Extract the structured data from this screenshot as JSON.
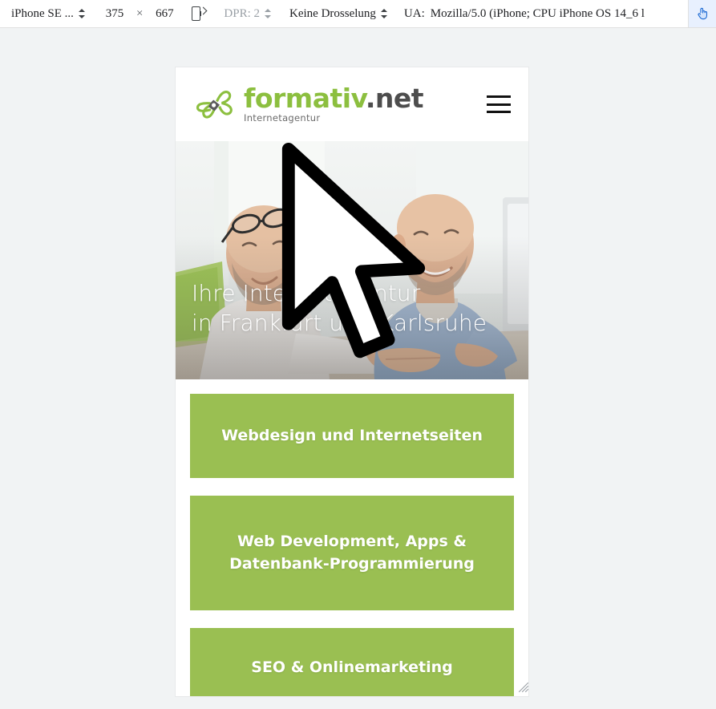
{
  "devtools_toolbar": {
    "device_name": "iPhone SE ...",
    "width": "375",
    "height": "667",
    "times_symbol": "×",
    "rotate_icon": "rotate-device-icon",
    "dpr_label": "DPR: 2",
    "throttling": "Keine Drosselung",
    "ua_label": "UA:",
    "ua_value": "Mozilla/5.0 (iPhone; CPU iPhone OS 14_6 l",
    "touch_icon": "touch-pointer-icon",
    "select_icon": "updown-chevron-icon",
    "background": "#ffffff",
    "touch_active_color": "#e8f0fe"
  },
  "site": {
    "header": {
      "logo_mark": "formativ-propeller-logo-icon",
      "brand_primary": "formativ",
      "brand_secondary": ".net",
      "tagline": "Internetagentur",
      "brand_green": "#8cbf3f",
      "brand_dark": "#4d4d4d",
      "menu_icon": "hamburger-menu-icon"
    },
    "hero": {
      "line1": "Ihre Internetagentur",
      "line2": "in Frankfurt und Karlsruhe",
      "image_alt": "two-men-at-desk-photo"
    },
    "services": [
      {
        "label": "Webdesign und Internetseiten"
      },
      {
        "label": "Web Development, Apps &\nDatenbank-Programmierung"
      },
      {
        "label": "SEO & Onlinemarketing"
      }
    ],
    "tile_color": "#9abf52"
  },
  "overlay": {
    "cursor": "mouse-arrow-cursor",
    "resize_handle": "viewport-resize-handle"
  }
}
